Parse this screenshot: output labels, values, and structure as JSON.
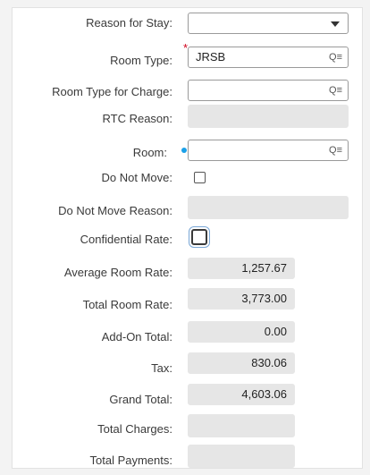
{
  "form": {
    "reason_for_stay": {
      "label": "Reason for Stay:",
      "value": ""
    },
    "room_type": {
      "label": "Room Type:",
      "value": "JRSB",
      "lookup_icon": "Q≡"
    },
    "room_type_for_charge": {
      "label": "Room Type for Charge:",
      "value": "",
      "lookup_icon": "Q≡"
    },
    "rtc_reason": {
      "label": "RTC Reason:",
      "value": ""
    },
    "room": {
      "label": "Room:",
      "value": "",
      "lookup_icon": "Q≡"
    },
    "do_not_move": {
      "label": "Do Not Move:",
      "checked": false
    },
    "do_not_move_reason": {
      "label": "Do Not Move Reason:",
      "value": ""
    },
    "confidential_rate": {
      "label": "Confidential Rate:",
      "checked": false
    },
    "average_room_rate": {
      "label": "Average Room Rate:",
      "value": "1,257.67"
    },
    "total_room_rate": {
      "label": "Total Room Rate:",
      "value": "3,773.00"
    },
    "add_on_total": {
      "label": "Add-On Total:",
      "value": "0.00"
    },
    "tax": {
      "label": "Tax:",
      "value": "830.06"
    },
    "grand_total": {
      "label": "Grand Total:",
      "value": "4,603.06"
    },
    "total_charges": {
      "label": "Total Charges:",
      "value": ""
    },
    "total_payments": {
      "label": "Total Payments:",
      "value": ""
    }
  },
  "colors": {
    "required": "#d0021b",
    "indicator": "#1aa0e8",
    "readonly_bg": "#e6e6e6"
  }
}
